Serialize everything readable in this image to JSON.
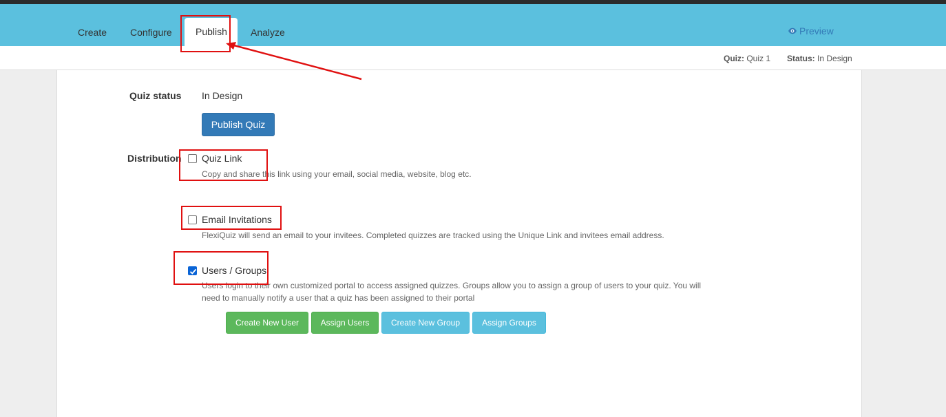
{
  "nav": {
    "tabs": [
      {
        "label": "Create"
      },
      {
        "label": "Configure"
      },
      {
        "label": "Publish"
      },
      {
        "label": "Analyze"
      }
    ],
    "preview_label": "Preview",
    "preview_icon": "eye-icon"
  },
  "info": {
    "quiz_key": "Quiz:",
    "quiz_value": "Quiz 1",
    "status_key": "Status:",
    "status_value": "In Design"
  },
  "quiz_status": {
    "label": "Quiz status",
    "value": "In Design",
    "publish_button": "Publish Quiz"
  },
  "distribution": {
    "label": "Distribution",
    "options": [
      {
        "label": "Quiz Link",
        "checked": false,
        "help": "Copy and share this link using your email, social media, website, blog etc."
      },
      {
        "label": "Email Invitations",
        "checked": false,
        "help": "FlexiQuiz will send an email to your invitees. Completed quizzes are tracked using the Unique Link and invitees email address."
      },
      {
        "label": "Users / Groups",
        "checked": true,
        "help_line1": "Users login to their own customized portal to access assigned quizzes. Groups allow you to assign a group of users to your quiz. You will",
        "help_line2": "need to manually notify a user that a quiz has been assigned to their portal"
      }
    ],
    "buttons": {
      "create_user": "Create New User",
      "assign_users": "Assign Users",
      "create_group": "Create New Group",
      "assign_groups": "Assign Groups"
    }
  },
  "colors": {
    "navbar": "#5bc0de",
    "primary": "#337ab7",
    "success": "#5cb85c",
    "info": "#5bc0de",
    "annotation": "#e01010"
  }
}
